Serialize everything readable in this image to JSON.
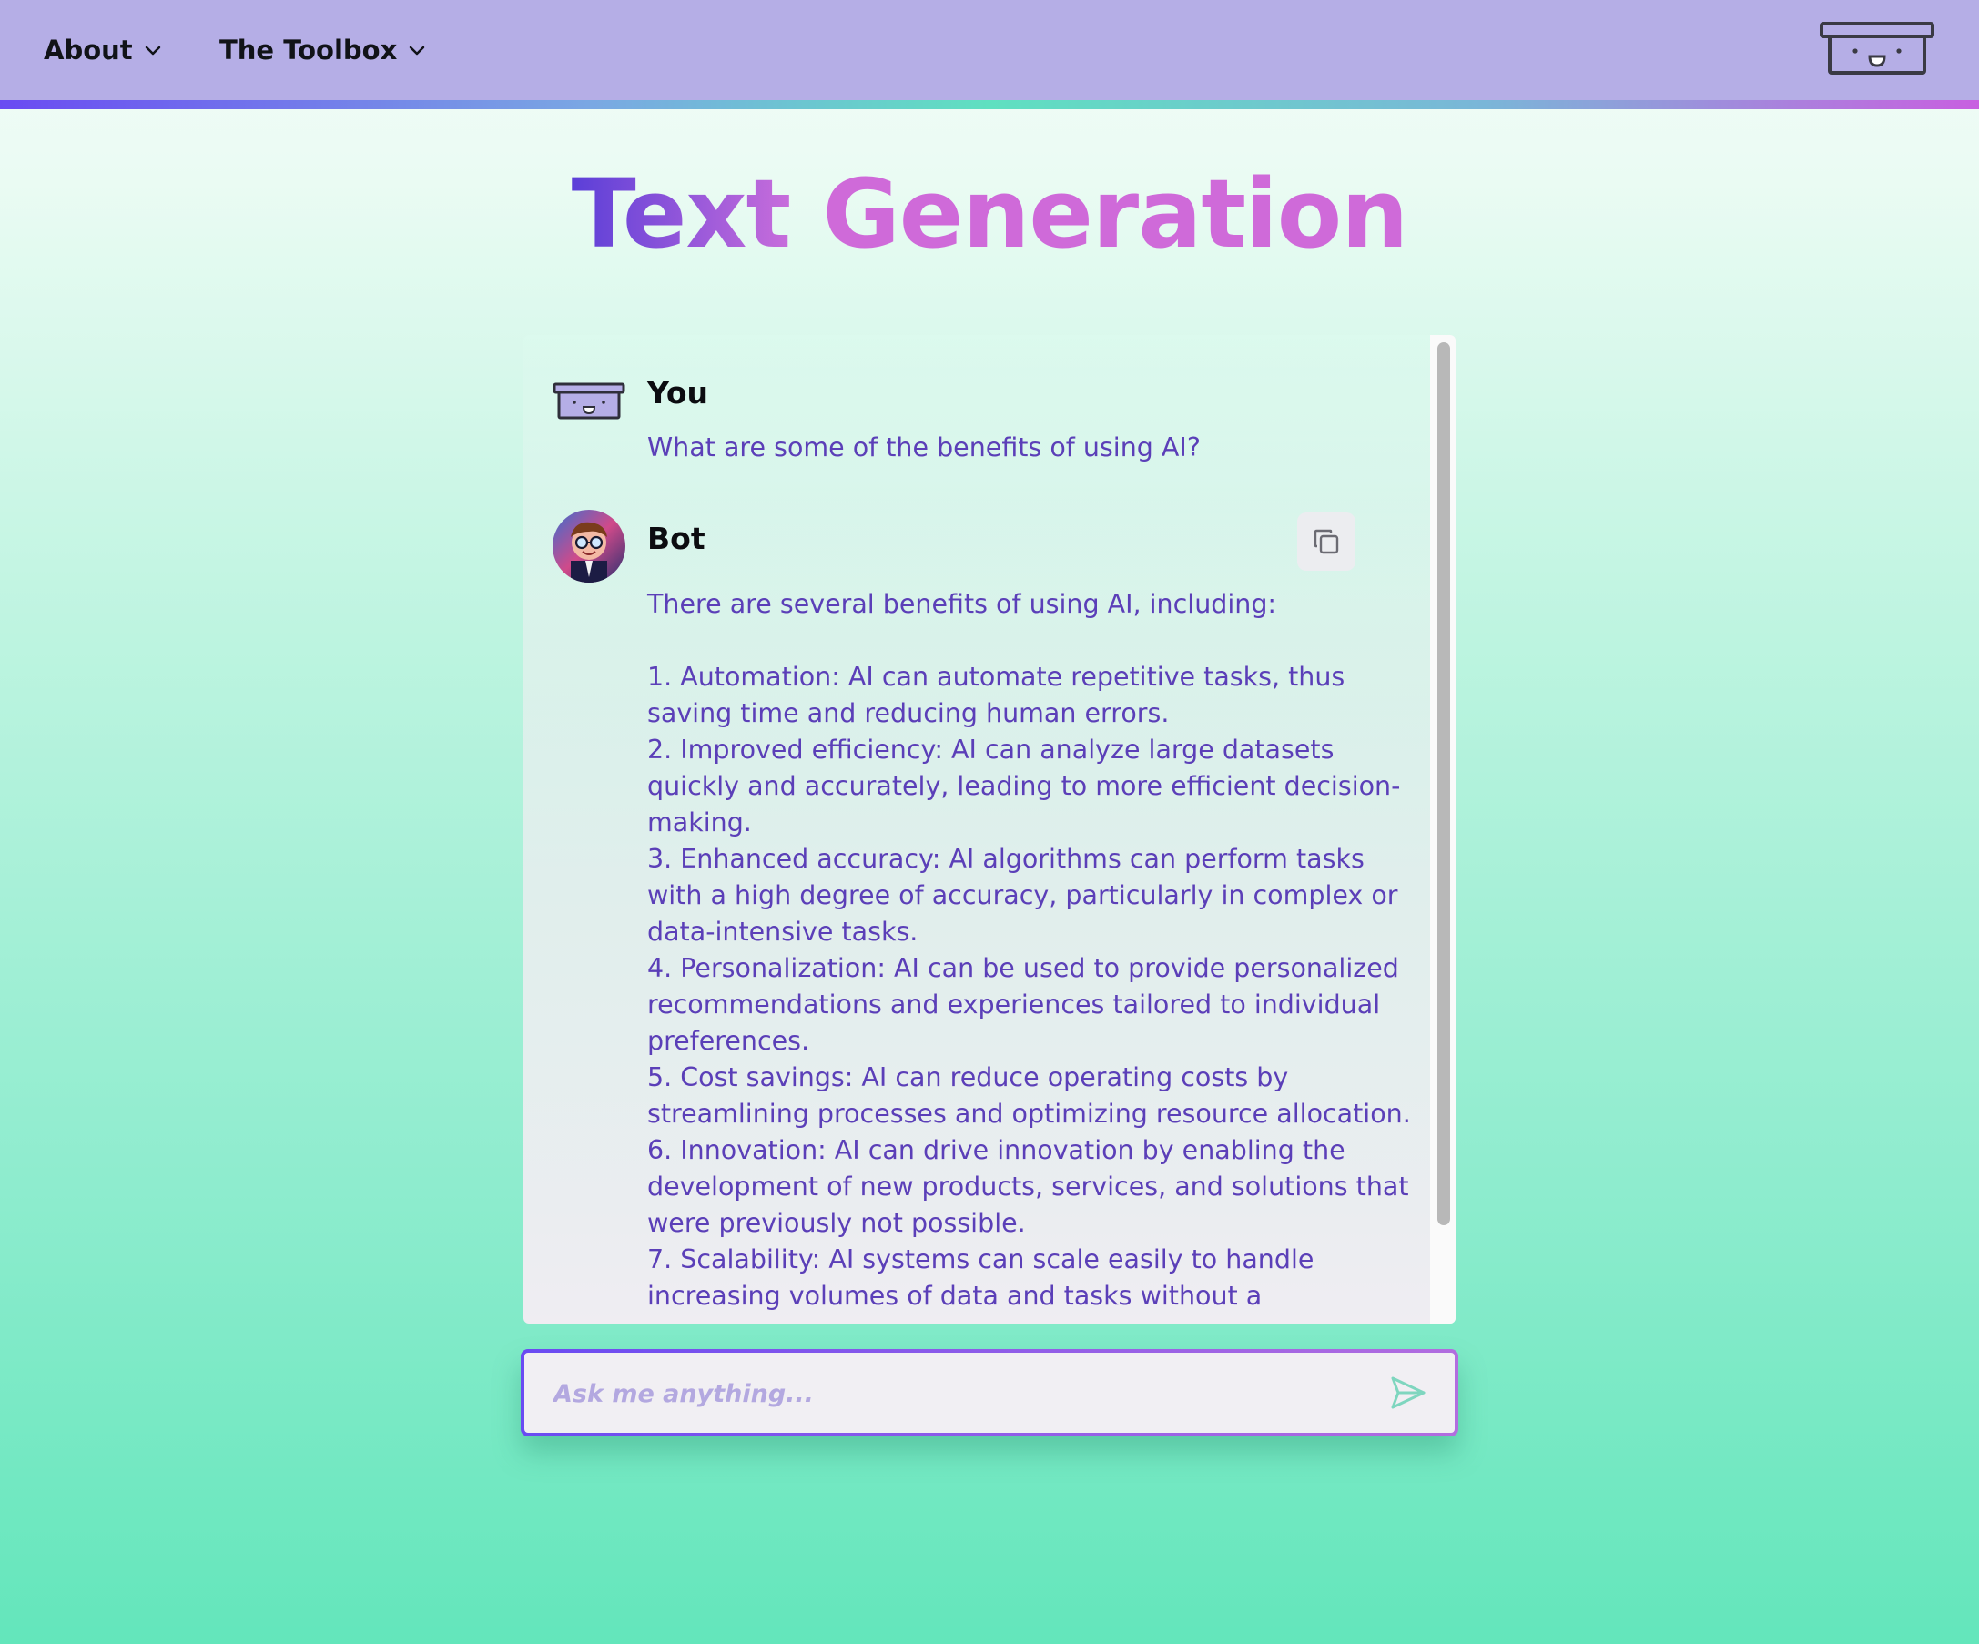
{
  "nav": {
    "items": [
      {
        "label": "About",
        "icon": "chevron-down-icon"
      },
      {
        "label": "The Toolbox",
        "icon": "chevron-down-icon"
      }
    ],
    "logo_icon": "toolbox-smile-icon"
  },
  "page": {
    "title_word_1": "Text",
    "title_word_2": "Generation"
  },
  "chat": {
    "messages": [
      {
        "sender": "You",
        "avatar": "toolbox-smile-icon",
        "text": "What are some of the benefits of using AI?"
      },
      {
        "sender": "Bot",
        "avatar": "bot-avatar",
        "copy_icon": "copy-icon",
        "text": "There are several benefits of using AI, including:\n\n1. Automation: AI can automate repetitive tasks, thus saving time and reducing human errors.\n2. Improved efficiency: AI can analyze large datasets quickly and accurately, leading to more efficient decision-making.\n3. Enhanced accuracy: AI algorithms can perform tasks with a high degree of accuracy, particularly in complex or data-intensive tasks.\n4. Personalization: AI can be used to provide personalized recommendations and experiences tailored to individual preferences.\n5. Cost savings: AI can reduce operating costs by streamlining processes and optimizing resource allocation.\n6. Innovation: AI can drive innovation by enabling the development of new products, services, and solutions that were previously not possible.\n7. Scalability: AI systems can scale easily to handle increasing volumes of data and tasks without a"
      }
    ]
  },
  "composer": {
    "placeholder": "Ask me anything...",
    "send_icon": "send-icon"
  },
  "colors": {
    "nav_bg": "#b5aee6",
    "accent_purple": "#6a4bf2",
    "accent_pink": "#cf6ad9",
    "message_text": "#5b3fb8",
    "background_mint": "#63e6bb"
  }
}
